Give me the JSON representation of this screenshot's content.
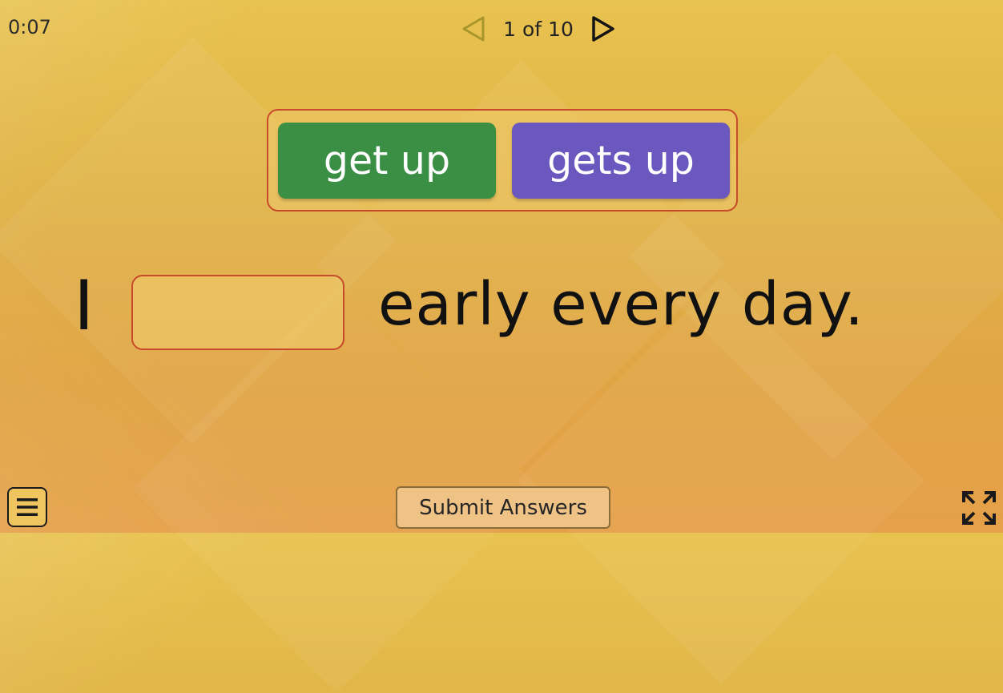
{
  "header": {
    "timer": "0:07",
    "page_indicator": "1 of 10",
    "prev_icon": "triangle-left-outline",
    "next_icon": "triangle-right-outline"
  },
  "choices": [
    {
      "label": "get up",
      "color": "#3b8f45"
    },
    {
      "label": "gets up",
      "color": "#6a58bf"
    }
  ],
  "sentence": {
    "before_blank": "I",
    "after_blank": "early every day."
  },
  "footer": {
    "submit_label": "Submit Answers",
    "menu_icon": "hamburger-menu-icon",
    "fullscreen_icon": "fullscreen-icon"
  },
  "colors": {
    "accent_border": "#c74a2a",
    "background": "#e1b448"
  }
}
